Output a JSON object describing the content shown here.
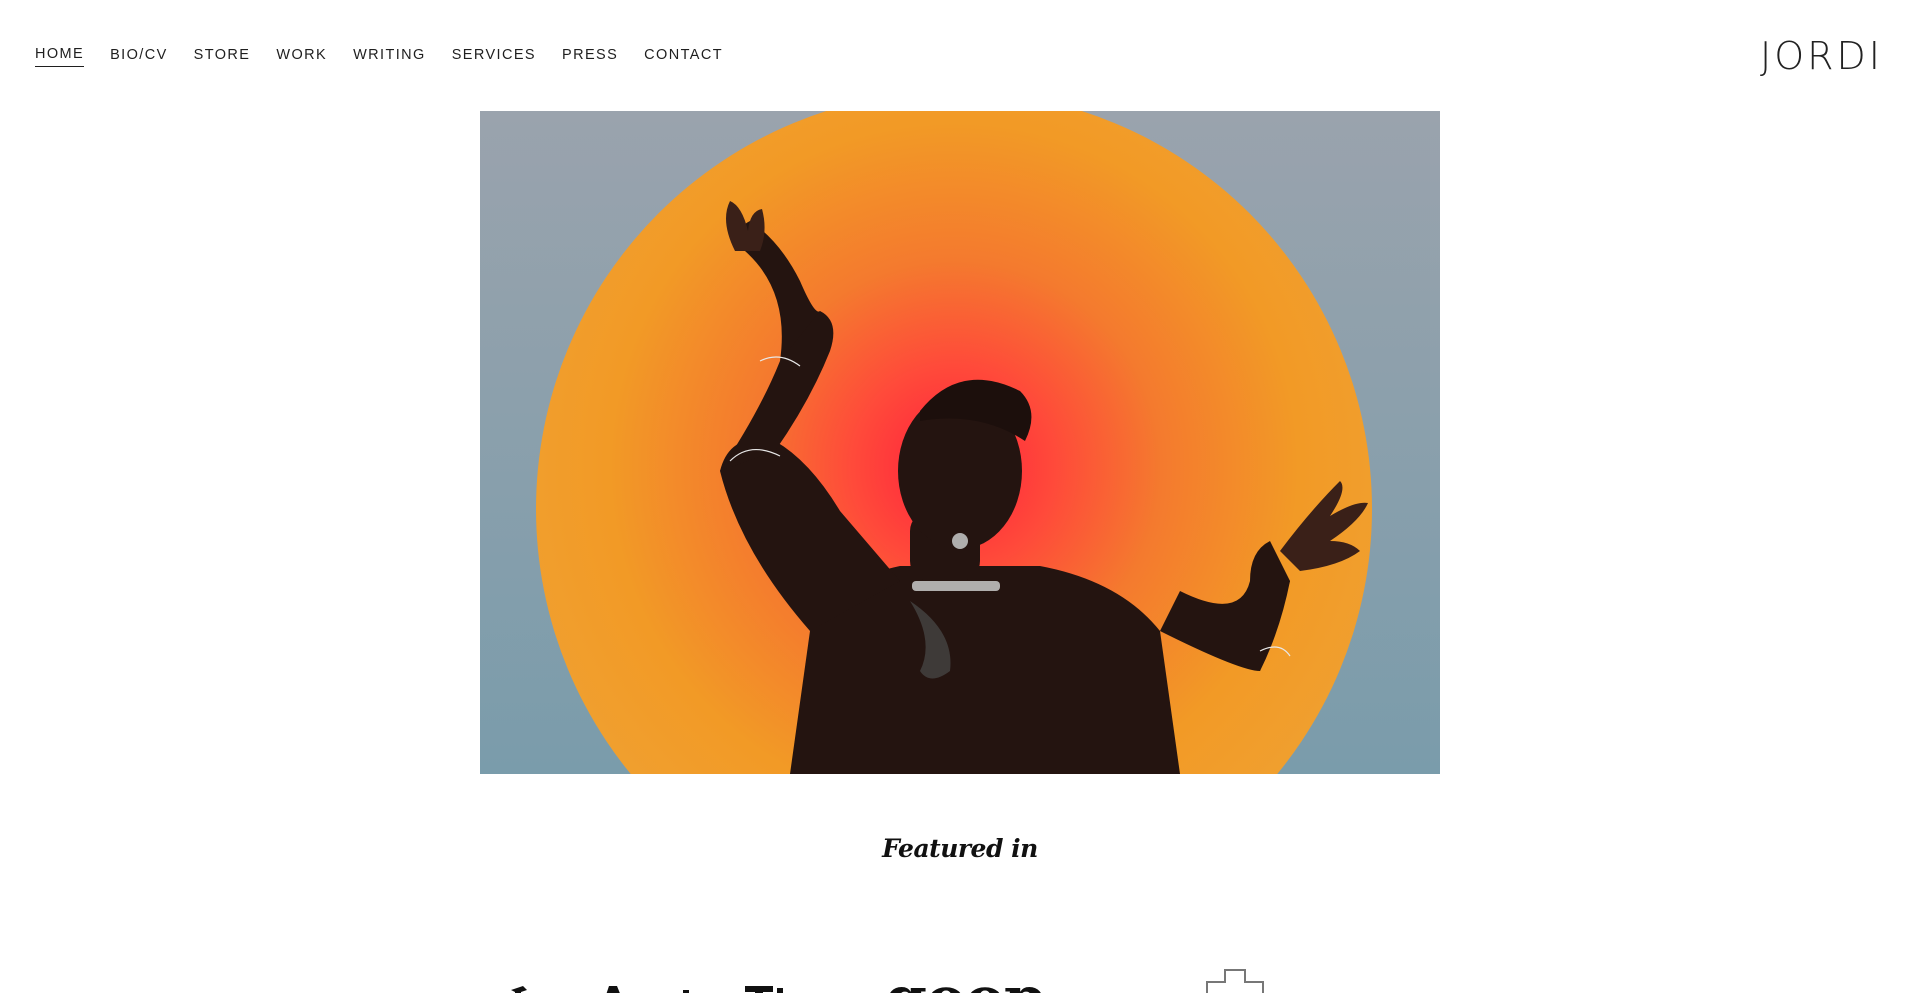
{
  "site": {
    "logo": "JORDI"
  },
  "nav": {
    "items": [
      {
        "label": "HOME",
        "active": true
      },
      {
        "label": "BIO/CV",
        "active": false
      },
      {
        "label": "STORE",
        "active": false
      },
      {
        "label": "WORK",
        "active": false
      },
      {
        "label": "WRITING",
        "active": false
      },
      {
        "label": "SERVICES",
        "active": false
      },
      {
        "label": "PRESS",
        "active": false
      },
      {
        "label": "CONTACT",
        "active": false
      }
    ]
  },
  "featured": {
    "title": "Featured in",
    "logos": [
      {
        "name": "Los Angeles Times",
        "icon": "los-angeles-times-logo"
      },
      {
        "name": "goop",
        "icon": "goop-logo"
      },
      {
        "name": "",
        "icon": "cross-logo"
      }
    ]
  },
  "colors": {
    "background": "#ffffff",
    "text": "#1f1f1f",
    "sun_orange": "#f29a26",
    "sun_red": "#ff3a3a",
    "sky": "#8ea2ad"
  }
}
